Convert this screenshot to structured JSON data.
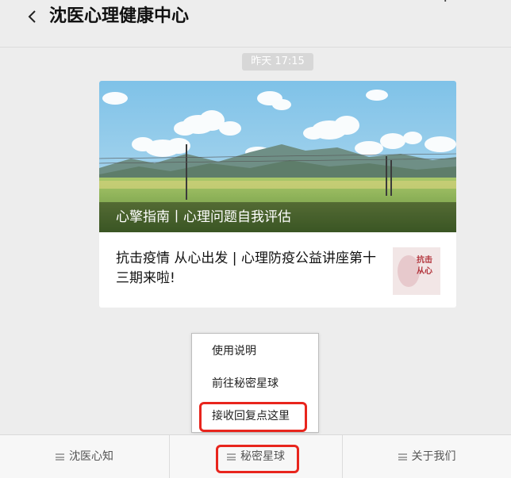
{
  "header": {
    "title": "沈医心理健康中心",
    "back_icon": "chevron-left-icon",
    "corner_glyph": "+"
  },
  "timestamp": "昨天 17:15",
  "article": {
    "cover_caption": "心擎指南丨心理问题自我评估",
    "sub_title": "抗击疫情 从心出发 | 心理防疫公益讲座第十三期来啦!",
    "thumb_text": "抗击\n从心"
  },
  "popup_menu": {
    "items": [
      {
        "label": "使用说明"
      },
      {
        "label": "前往秘密星球"
      },
      {
        "label": "接收回复点这里"
      }
    ],
    "highlight_color": "#e8251d"
  },
  "bottom_menu": {
    "items": [
      {
        "label": "沈医心知",
        "icon": "menu-lines-icon"
      },
      {
        "label": "秘密星球",
        "icon": "menu-lines-icon"
      },
      {
        "label": "关于我们",
        "icon": "menu-lines-icon"
      }
    ]
  }
}
